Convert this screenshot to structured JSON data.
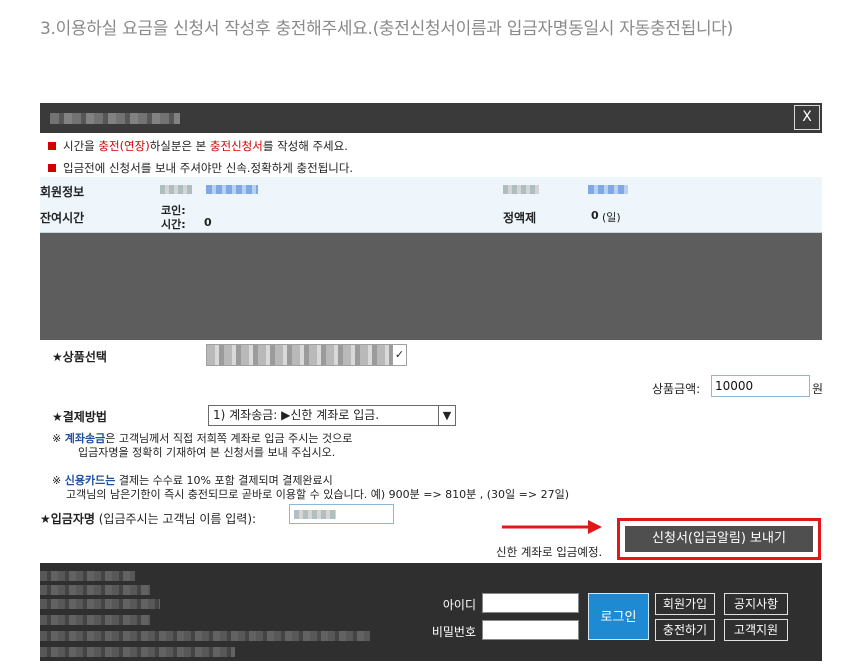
{
  "heading": "3.이용하실 요금을 신청서 작성후 충전해주세요.(충전신청서이름과 입금자명동일시 자동충전됩니다)",
  "dialog": {
    "close_label": "X",
    "notice1": {
      "part1": "시간을 ",
      "red1": "충전(연장)",
      "part2": "하실분은  본  ",
      "red2": "충전신청서",
      "part3": "를 작성해 주세요."
    },
    "notice2": "입금전에 신청서를 보내 주셔야만 신속.정확하게 충전됩니다.",
    "member_info_label": "회원정보",
    "remaining_time_label": "잔여시간",
    "coin_label": "코인:",
    "time_label": "시간:",
    "time_value": "0",
    "fixed_rate_label": "정액제",
    "fixed_rate_value": "0",
    "fixed_rate_unit": "(일)",
    "product_select_label": "★상품선택",
    "price_label": "상품금액:",
    "price_value": "10000",
    "price_unit": "원",
    "payment_method_label": "★결제방법",
    "payment_method_value": "1) 계좌송금: ▶신한 계좌로 입금.",
    "desc1": {
      "prefix": "※ ",
      "blue": "계좌송금",
      "rest": "은 고객님께서  직접 저희쪽 계좌로 입금 주시는 것으로"
    },
    "desc2": "입금자명을 정확히 기재하여   본  신청서를  보내 주십시오.",
    "desc3": {
      "prefix": "※ ",
      "blue": "신용카드는",
      "rest": " 결제는 수수료 10% 포함 결제되며 결제완료시"
    },
    "desc4": "고객님의 남은기한이 즉시 충전되므로 곧바로 이용할 수 있습니다. 예) 900분 => 810분 , (30일 => 27일)",
    "depositor_label": "★입금자명",
    "depositor_hint": " (입금주시는 고객님 이름 입력):",
    "send_button": "신청서(입금알림) 보내기",
    "bank_note": "신한 계좌로 입금예정."
  },
  "footer": {
    "id_label": "아이디",
    "password_label": "비밀번호",
    "login_button": "로그인",
    "signup_button": "회원가입",
    "notice_button": "공지사항",
    "charge_button": "충전하기",
    "support_button": "고객지원"
  },
  "colors": {
    "accent_red": "#d40000",
    "highlight_red": "#e01818",
    "login_blue": "#1e8ad4",
    "link_blue": "#1f4fa0",
    "value_pink": "#b0306a"
  }
}
